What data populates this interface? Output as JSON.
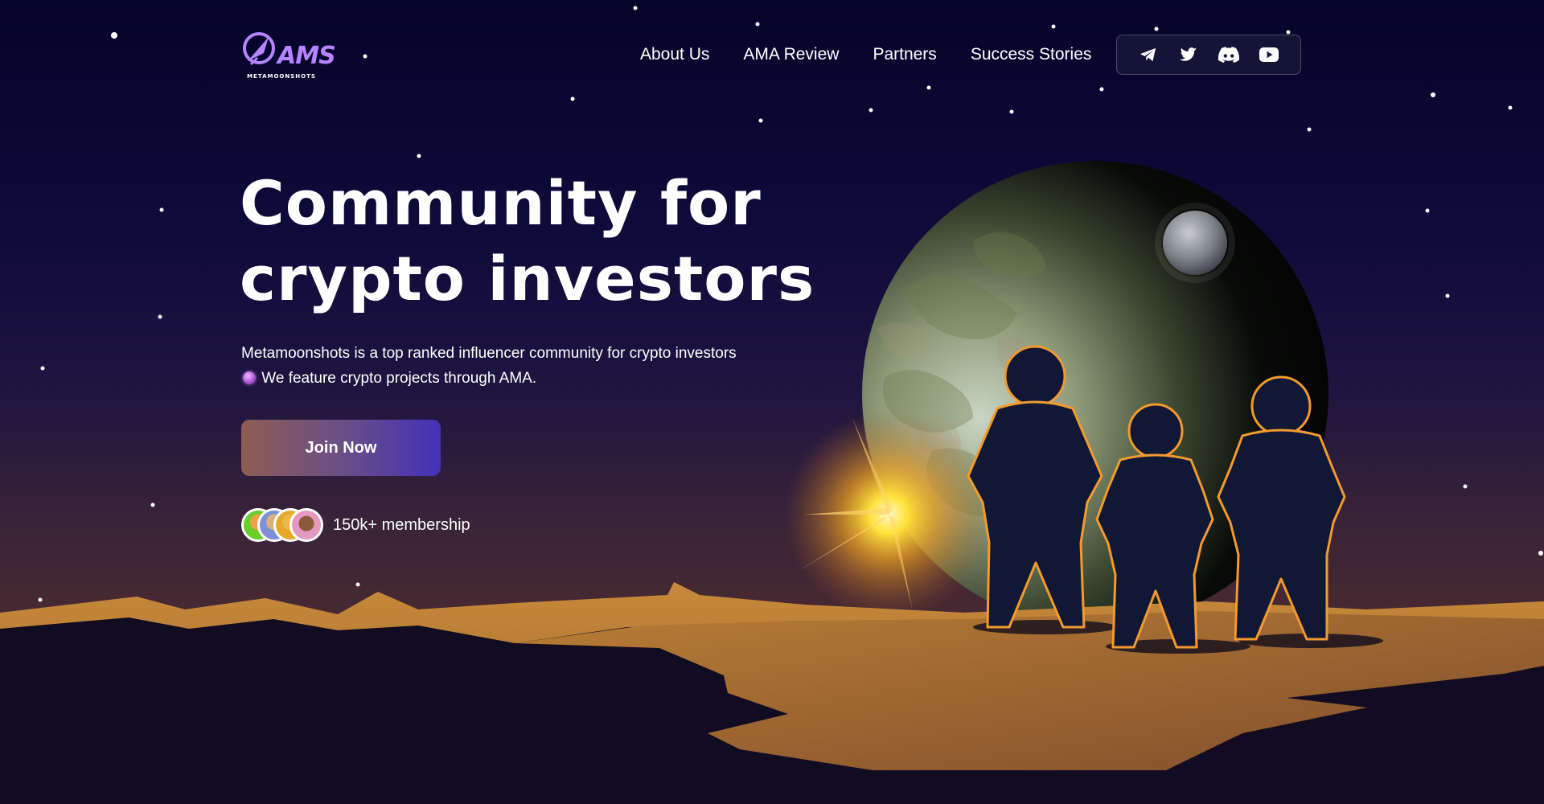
{
  "brand": {
    "logo_text": "AMS",
    "logo_sub": "METAMOONSHOTS"
  },
  "nav": {
    "items": [
      {
        "label": "About Us"
      },
      {
        "label": "AMA Review"
      },
      {
        "label": "Partners"
      },
      {
        "label": "Success Stories"
      }
    ]
  },
  "social": {
    "icons": [
      "telegram-icon",
      "twitter-icon",
      "discord-icon",
      "youtube-icon"
    ]
  },
  "hero": {
    "title_line1": "Community for",
    "title_line2": "crypto investors",
    "desc_part1": "Metamoonshots is a top ranked influencer community for crypto investors",
    "desc_part2": " We feature crypto projects through AMA.",
    "cta_label": "Join Now",
    "members_label": "150k+ membership"
  },
  "colors": {
    "accent_purple": "#b784ff",
    "button_start": "#8e5c52",
    "button_end": "#4431b8",
    "ground": "#c78a3a",
    "outline_orange": "#f29a2e",
    "sky_top": "#05042a"
  }
}
